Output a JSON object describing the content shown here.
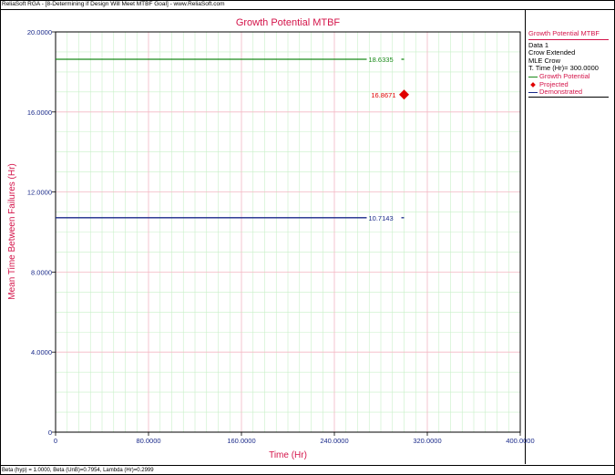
{
  "window": {
    "title": "ReliaSoft RGA - [8-Determining if Design Will Meet MTBF Goal] - www.ReliaSoft.com",
    "status": "Beta (hyp) = 1.0000, Beta (UnB)=0.7954, Lambda (Hr)=0.2999"
  },
  "legend": {
    "title": "Growth Potential MTBF",
    "lines": [
      "Data 1",
      "Crow Extended",
      "MLE Crow",
      "T. Time (Hr)= 300.0000"
    ],
    "items": [
      {
        "label": "Growth Potential",
        "color": "#1a8a1a",
        "kind": "line"
      },
      {
        "label": "Projected",
        "color": "#e00000",
        "kind": "diamond"
      },
      {
        "label": "Demonstrated",
        "color": "#1a2a8a",
        "kind": "line"
      }
    ]
  },
  "chart_data": {
    "type": "line",
    "title": "Growth Potential MTBF",
    "xlabel": "Time (Hr)",
    "ylabel": "Mean Time Between Failures (Hr)",
    "xlim": [
      0,
      400
    ],
    "ylim": [
      0,
      20
    ],
    "xticks": [
      0,
      80,
      160,
      240,
      320,
      400
    ],
    "xtick_labels": [
      "0",
      "80.0000",
      "160.0000",
      "240.0000",
      "320.0000",
      "400.0000"
    ],
    "yticks": [
      0,
      4,
      8,
      12,
      16,
      20
    ],
    "ytick_labels": [
      "0",
      "4.0000",
      "8.0000",
      "12.0000",
      "16.0000",
      "20.0000"
    ],
    "grid": true,
    "series": [
      {
        "name": "Growth Potential",
        "color": "#1a8a1a",
        "x": [
          0,
          300
        ],
        "y": [
          18.6335,
          18.6335
        ],
        "end_label": "18.6335"
      },
      {
        "name": "Demonstrated",
        "color": "#1a2a8a",
        "x": [
          0,
          300
        ],
        "y": [
          10.7143,
          10.7143
        ],
        "end_label": "10.7143"
      }
    ],
    "points": [
      {
        "name": "Projected",
        "color": "#e00000",
        "x": 300,
        "y": 16.8671,
        "label": "16.8671"
      }
    ]
  }
}
